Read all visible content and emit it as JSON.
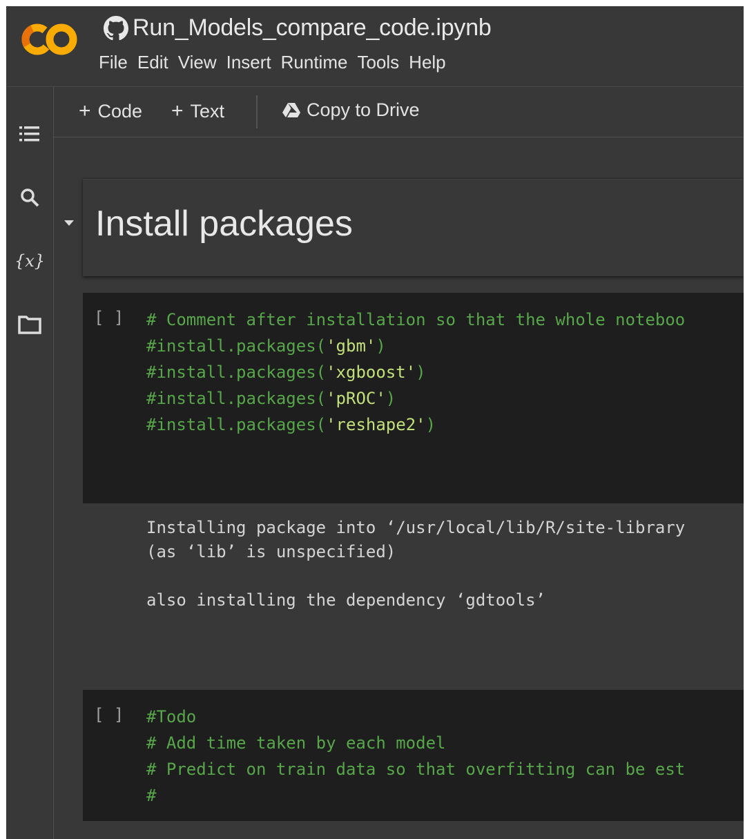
{
  "header": {
    "notebook_title": "Run_Models_compare_code.ipynb",
    "menu": [
      "File",
      "Edit",
      "View",
      "Insert",
      "Runtime",
      "Tools",
      "Help"
    ]
  },
  "sidebar": {
    "items": [
      {
        "icon": "table-of-contents-icon"
      },
      {
        "icon": "search-icon"
      },
      {
        "icon": "variables-icon",
        "glyph": "{x}"
      },
      {
        "icon": "folder-icon"
      }
    ]
  },
  "toolbar": {
    "plus": "+",
    "code_label": "Code",
    "text_label": "Text",
    "copy_label": "Copy to Drive"
  },
  "cells": {
    "heading": "Install packages",
    "cell1": {
      "bracket": "[ ]",
      "line1": "# Comment after installation so that the whole noteboo",
      "line2_prefix": "#install.packages(",
      "line2_str": "'gbm'",
      "line3_prefix": "#install.packages(",
      "line3_str": "'xgboost'",
      "line4_prefix": "#install.packages(",
      "line4_str": "'pROC'",
      "line5_prefix": "#install.packages(",
      "line5_str": "'reshape2'",
      "close": ")"
    },
    "output": {
      "line1": "Installing package into ‘/usr/local/lib/R/site-library",
      "line2": "(as ‘lib’ is unspecified)",
      "line3": "also installing the dependency ‘gdtools’"
    },
    "cell2": {
      "bracket": "[ ]",
      "line1": "#Todo",
      "line2": "# Add time taken by each model",
      "line3": "# Predict on train data so that overfitting can be est",
      "line4": "#"
    }
  },
  "colors": {
    "background": "#383838",
    "code_bg": "#1e1e1e",
    "comment": "#57a64a",
    "string": "#c2e07a",
    "logo_orange": "#f9ab00",
    "logo_dark_orange": "#e8710a"
  }
}
